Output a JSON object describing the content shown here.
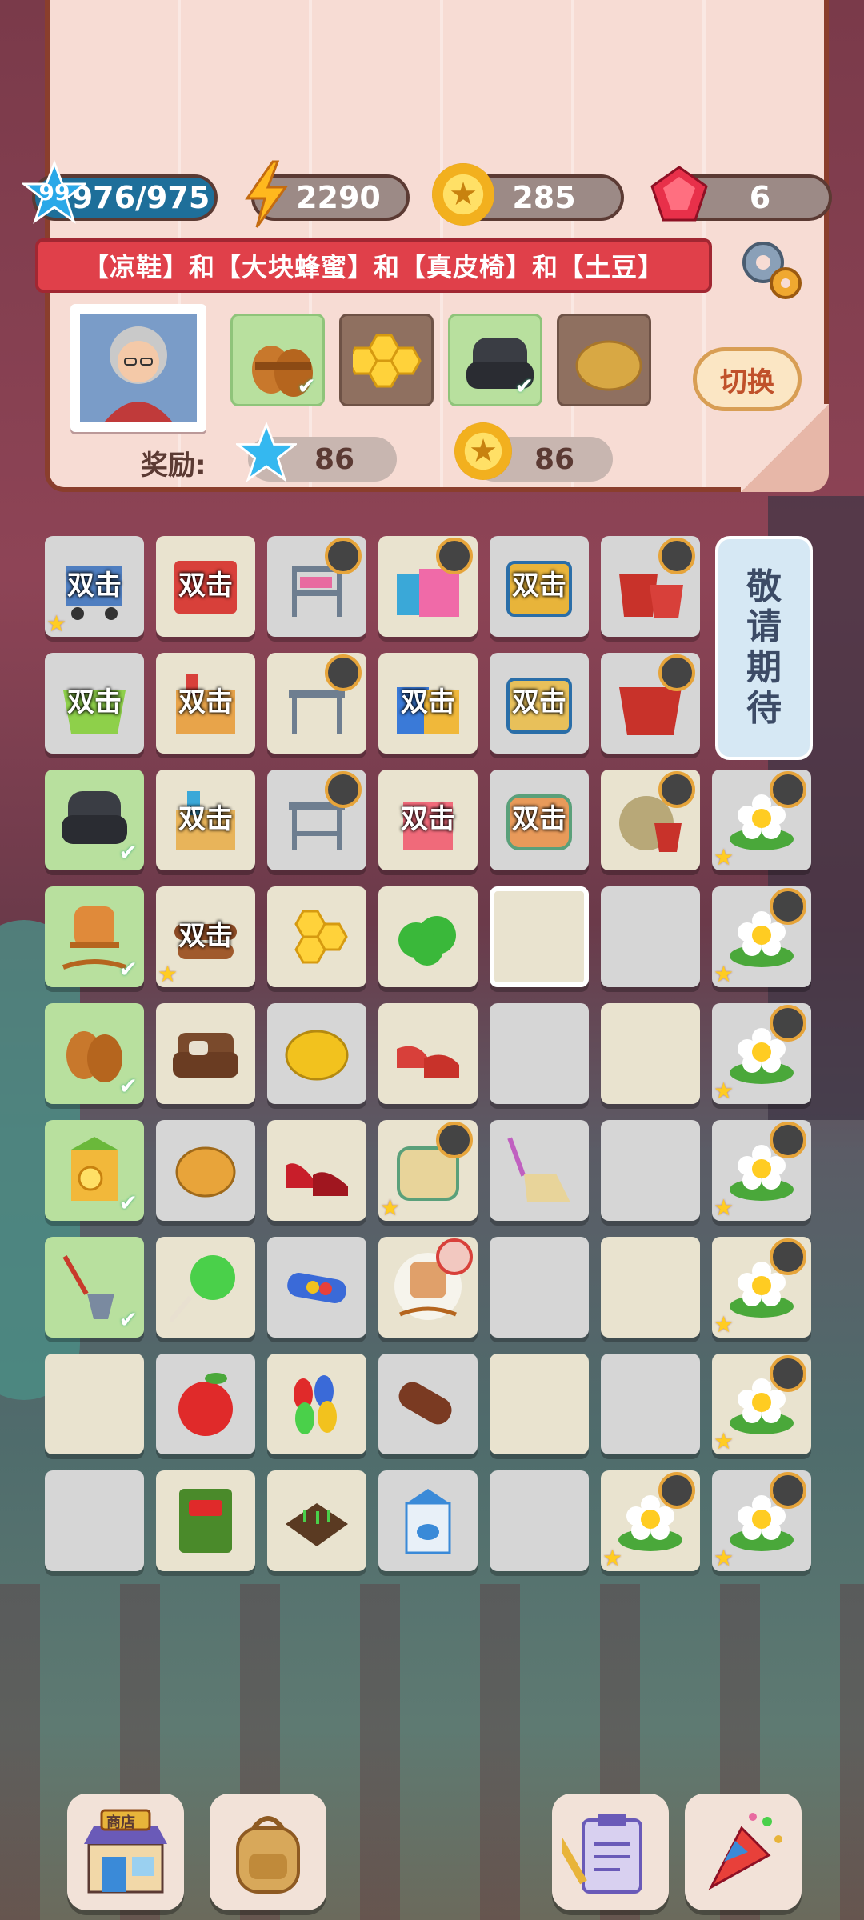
{
  "header": {
    "level": "99",
    "level_progress": "976/975",
    "energy": "2290",
    "coins": "285",
    "gems": "6"
  },
  "order": {
    "banner": "【凉鞋】和【大块蜂蜜】和【真皮椅】和【土豆】",
    "items": [
      {
        "name": "凉鞋",
        "done": true
      },
      {
        "name": "大块蜂蜜",
        "done": false
      },
      {
        "name": "真皮椅",
        "done": true
      },
      {
        "name": "土豆",
        "done": false
      }
    ],
    "swap_label": "切换",
    "reward_label": "奖励:",
    "reward_stars": "86",
    "reward_coins": "86"
  },
  "board": {
    "double_label": "双击",
    "coming_soon": [
      "敬",
      "请",
      "期",
      "待"
    ]
  },
  "colors": {
    "accent": "#e0404a",
    "panel": "#f7dcd4",
    "done": "#b8e09e"
  },
  "toolbar": {
    "shop_sign": "商店",
    "icons": [
      "shop-icon",
      "backpack-icon",
      "task-list-icon",
      "party-icon"
    ]
  }
}
